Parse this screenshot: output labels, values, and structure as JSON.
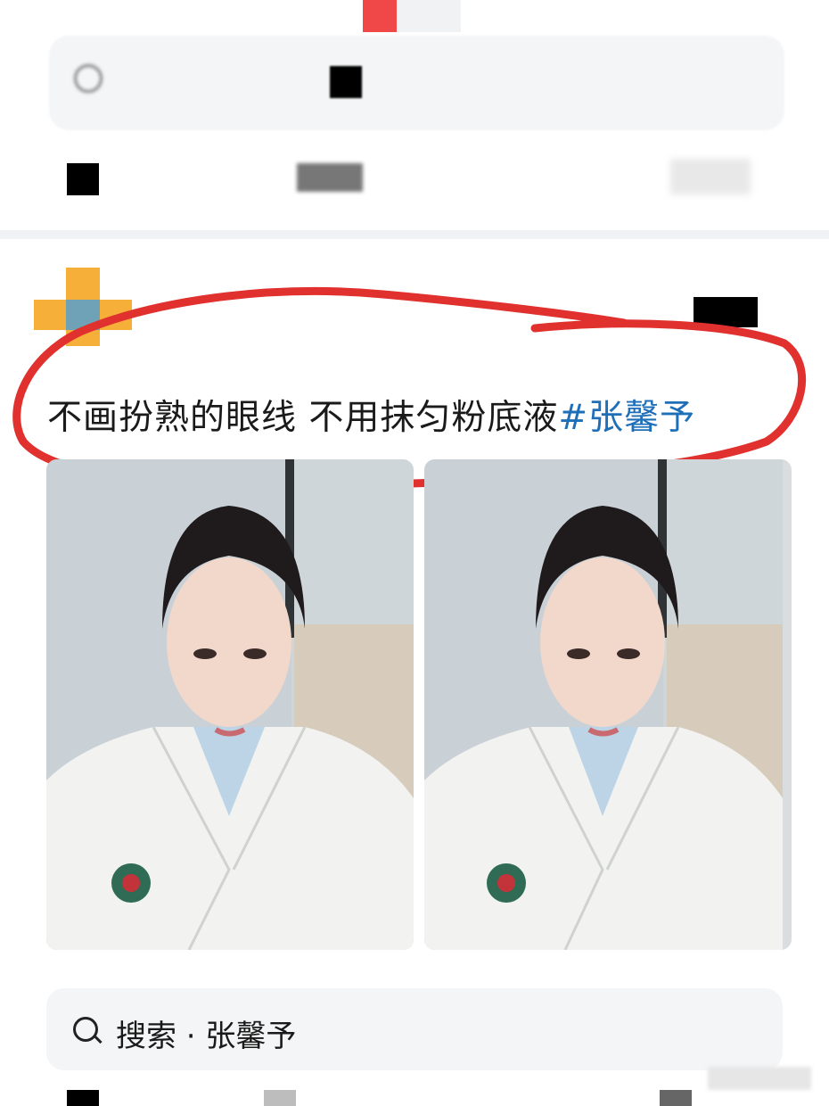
{
  "post": {
    "text": "不画扮熟的眼线 不用抹匀粉底液",
    "hashtag": "#张馨予"
  },
  "bottom_search": {
    "label": "搜索 · 张馨予"
  },
  "colors": {
    "hashtag": "#1e6fb8",
    "annotation": "#e0312e",
    "search_bg": "#f4f5f7"
  },
  "icons": [
    "search-icon"
  ]
}
